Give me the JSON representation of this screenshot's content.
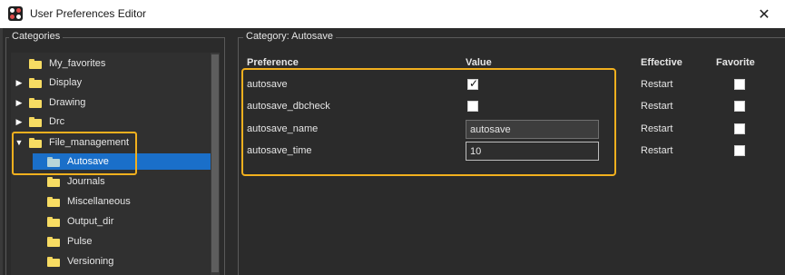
{
  "window": {
    "title": "User Preferences Editor",
    "close_glyph": "✕"
  },
  "categories": {
    "legend": "Categories",
    "items": [
      {
        "label": "My_favorites",
        "expander": "",
        "selected": false
      },
      {
        "label": "Display",
        "expander": "▶",
        "selected": false
      },
      {
        "label": "Drawing",
        "expander": "▶",
        "selected": false
      },
      {
        "label": "Drc",
        "expander": "▶",
        "selected": false
      },
      {
        "label": "File_management",
        "expander": "▼",
        "selected": false
      },
      {
        "label": "Autosave",
        "expander": "",
        "selected": true
      },
      {
        "label": "Journals",
        "expander": "",
        "selected": false
      },
      {
        "label": "Miscellaneous",
        "expander": "",
        "selected": false
      },
      {
        "label": "Output_dir",
        "expander": "",
        "selected": false
      },
      {
        "label": "Pulse",
        "expander": "",
        "selected": false
      },
      {
        "label": "Versioning",
        "expander": "",
        "selected": false
      }
    ]
  },
  "preferences": {
    "legend": "Category:  Autosave",
    "headers": {
      "preference": "Preference",
      "value": "Value",
      "effective": "Effective",
      "favorite": "Favorite"
    },
    "rows": [
      {
        "name": "autosave",
        "value_type": "checkbox",
        "checked": true,
        "check_glyph": "✓",
        "effective": "Restart",
        "favorite": false
      },
      {
        "name": "autosave_dbcheck",
        "value_type": "checkbox",
        "checked": false,
        "effective": "Restart",
        "favorite": false
      },
      {
        "name": "autosave_name",
        "value_type": "text",
        "value": "autosave",
        "effective": "Restart",
        "favorite": false
      },
      {
        "name": "autosave_time",
        "value_type": "text",
        "value": "10",
        "effective": "Restart",
        "favorite": false
      }
    ]
  },
  "colors": {
    "highlight": "#f2b01e",
    "selection": "#1a6fc9",
    "folder": "#f7dc63"
  }
}
